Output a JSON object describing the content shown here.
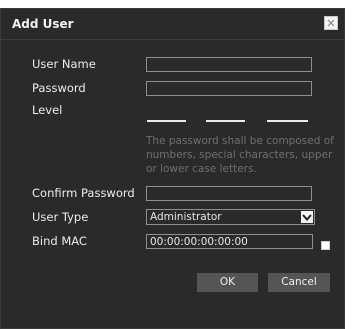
{
  "dialog": {
    "title": "Add User",
    "close_icon": "close-icon"
  },
  "form": {
    "username": {
      "label": "User Name",
      "value": ""
    },
    "password": {
      "label": "Password",
      "value": ""
    },
    "level": {
      "label": "Level",
      "hint": "The password shall be composed of numbers, special characters, upper or lower case letters."
    },
    "confirm_password": {
      "label": "Confirm Password",
      "value": ""
    },
    "user_type": {
      "label": "User Type",
      "value": "Administrator",
      "arrow_icon": "chevron-down-icon"
    },
    "bind_mac": {
      "label": "Bind MAC",
      "value": "00:00:00:00:00:00",
      "checked": false
    }
  },
  "buttons": {
    "ok": "OK",
    "cancel": "Cancel"
  },
  "colors": {
    "dialog_bg": "#2a2a2a",
    "text": "#ececec",
    "hint": "#6f6f6f",
    "button_bg": "#555555",
    "field_border": "#8e8e8e"
  }
}
